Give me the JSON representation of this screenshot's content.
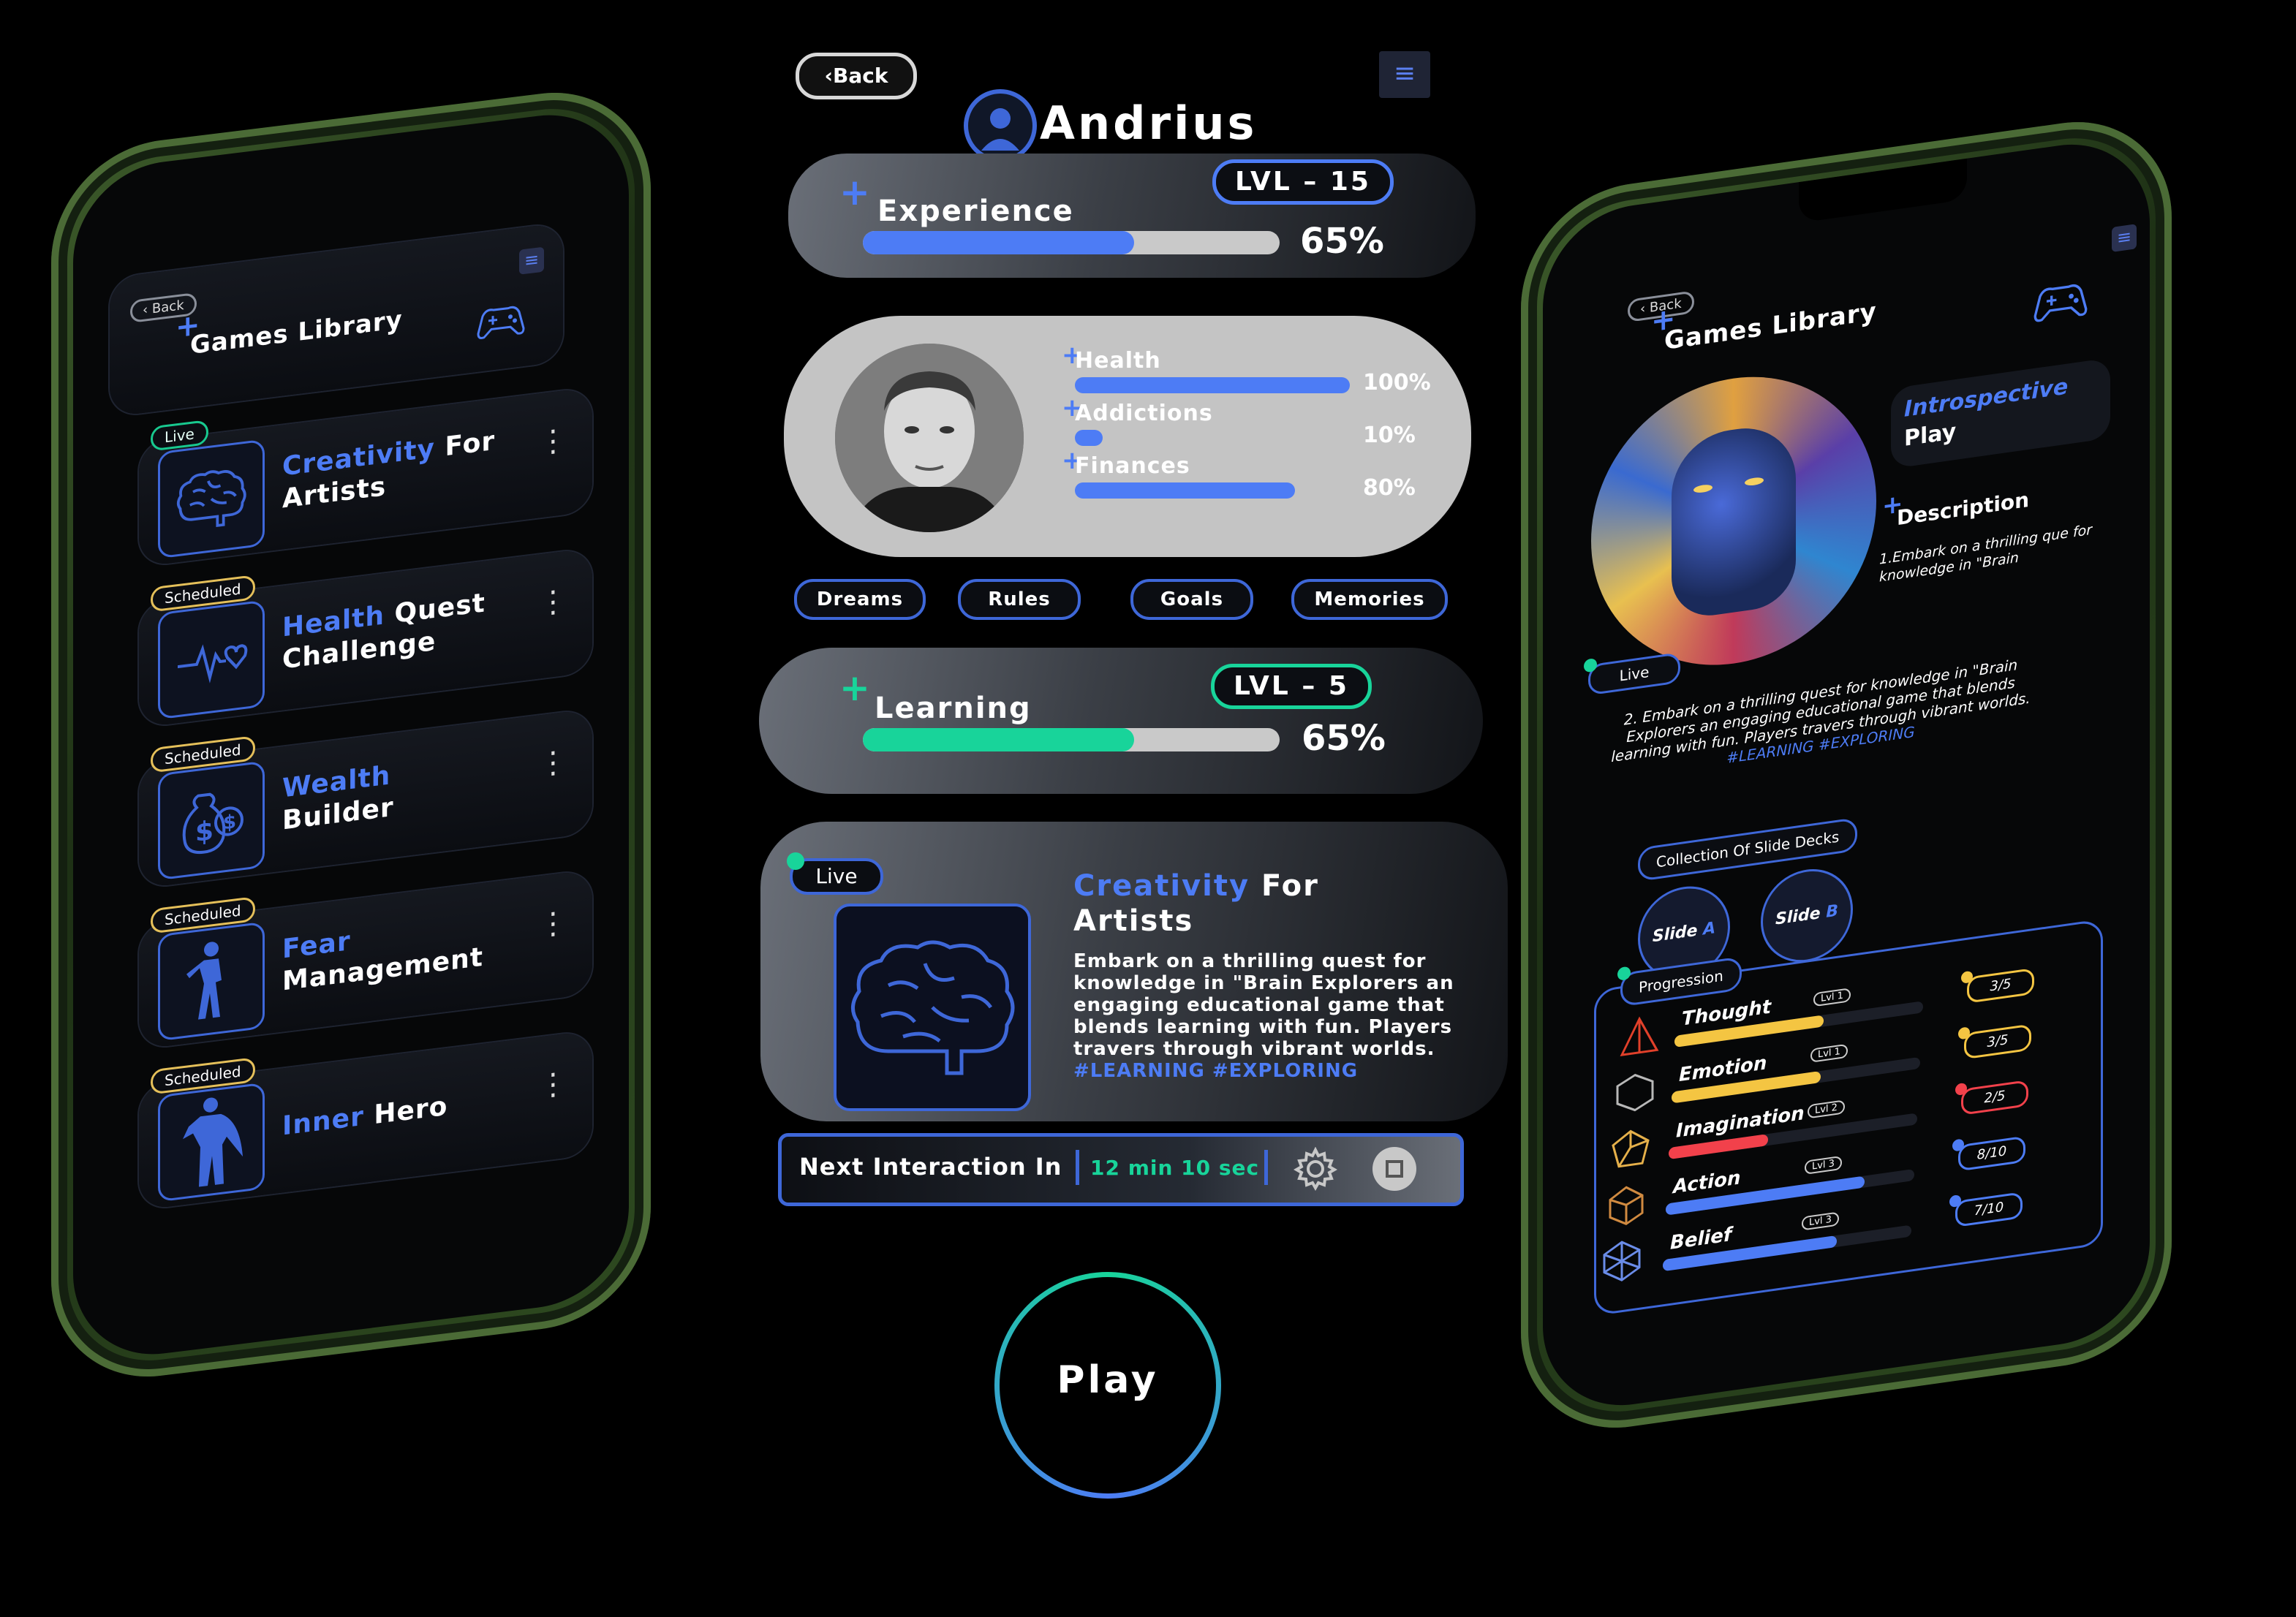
{
  "left_phone": {
    "back_label": "‹ Back",
    "title": "Games Library",
    "games": [
      {
        "tag": "Live",
        "title_accent": "Creativity",
        "title_rest": " For",
        "title_line2": "Artists",
        "icon": "brain-icon"
      },
      {
        "tag": "Scheduled",
        "title_accent": "Health",
        "title_rest": " Quest",
        "title_line2": "Challenge",
        "icon": "heartbeat-icon"
      },
      {
        "tag": "Scheduled",
        "title_accent": "Wealth",
        "title_rest": "",
        "title_line2": "Builder",
        "icon": "money-bag-icon"
      },
      {
        "tag": "Scheduled",
        "title_accent": "Fear",
        "title_rest": "",
        "title_line2": "Management",
        "icon": "figure-icon"
      },
      {
        "tag": "Scheduled",
        "title_accent": "Inner",
        "title_rest": " Hero",
        "title_line2": "",
        "icon": "hero-icon"
      }
    ]
  },
  "center": {
    "back_label": "‹Back",
    "user_name": "Andrius",
    "experience": {
      "label": "Experience",
      "level": "LVL – 15",
      "percent_label": "65%",
      "progress": 0.65
    },
    "stats": [
      {
        "label": "Health",
        "value": "100%",
        "progress": 1.0
      },
      {
        "label": "Addictions",
        "value": "10%",
        "progress": 0.1
      },
      {
        "label": "Finances",
        "value": "80%",
        "progress": 0.8
      }
    ],
    "tabs": [
      "Dreams",
      "Rules",
      "Goals",
      "Memories"
    ],
    "learning": {
      "label": "Learning",
      "level": "LVL – 5",
      "percent_label": "65%",
      "progress": 0.65
    },
    "feature": {
      "tag": "Live",
      "title_accent": "Creativity",
      "title_rest": " For",
      "title_line2": "Artists",
      "description": "Embark on a thrilling quest for knowledge in \"Brain Explorers an engaging educational game that blends learning with fun. Players travers through vibrant worlds.",
      "hashtag1": "#LEARNING",
      "hashtag2": "#EXPLORING"
    },
    "next_interaction": {
      "label": "Next Interaction In",
      "time": "12 min 10 sec"
    },
    "play_label": "Play"
  },
  "right_phone": {
    "back_label": "‹ Back",
    "title": "Games Library",
    "mode_accent": "Introspective",
    "mode_rest": "Play",
    "description_label": "Description",
    "live_tag": "Live",
    "desc1": "1.Embark on a thrilling que for knowledge in \"Brain",
    "desc2": "2. Embark on a thrilling quest for knowledge in \"Brain Explorers an engaging educational game that blends learning with fun. Players travers through vibrant worlds.",
    "desc2_tags": "#LEARNING #EXPLORING",
    "slides_label": "Collection Of Slide Decks",
    "slides": [
      {
        "name": "Slide",
        "letter": "A"
      },
      {
        "name": "Slide",
        "letter": "B"
      }
    ],
    "progression_label": "Progression",
    "progression": [
      {
        "name": "Thought",
        "level": "Lvl 1",
        "score": "3/5",
        "progress": 0.6,
        "color": "#f4c542"
      },
      {
        "name": "Emotion",
        "level": "Lvl 1",
        "score": "3/5",
        "progress": 0.6,
        "color": "#f4c542"
      },
      {
        "name": "Imagination",
        "level": "Lvl 2",
        "score": "2/5",
        "progress": 0.4,
        "color": "#f2414b"
      },
      {
        "name": "Action",
        "level": "Lvl 3",
        "score": "8/10",
        "progress": 0.8,
        "color": "#4d7cf5"
      },
      {
        "name": "Belief",
        "level": "Lvl 3",
        "score": "7/10",
        "progress": 0.7,
        "color": "#4d7cf5"
      }
    ]
  },
  "colors": {
    "accent": "#4d7cf5",
    "teal": "#18d49a",
    "gold": "#e5c05a"
  }
}
